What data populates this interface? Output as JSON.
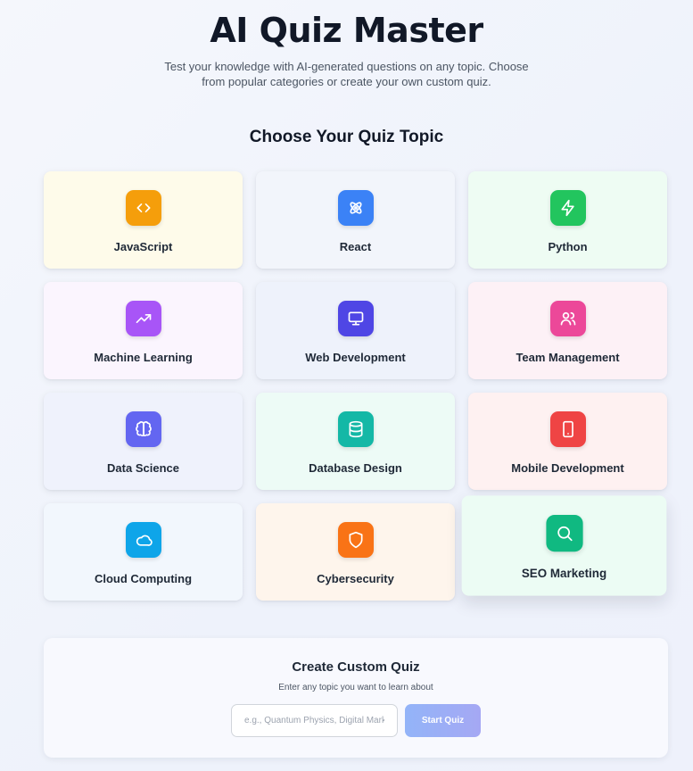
{
  "header": {
    "title": "AI Quiz Master",
    "subtitle": "Test your knowledge with AI-generated questions on any topic. Choose from popular categories or create your own custom quiz."
  },
  "topics_section": {
    "title": "Choose Your Quiz Topic",
    "topics": [
      {
        "label": "JavaScript",
        "icon": "code-icon",
        "accent": "#f59e0b",
        "bg": "#fefbea"
      },
      {
        "label": "React",
        "icon": "atom-icon",
        "accent": "#3b82f6",
        "bg": "#f2f5fb"
      },
      {
        "label": "Python",
        "icon": "lightning-icon",
        "accent": "#22c55e",
        "bg": "#eefcf3"
      },
      {
        "label": "Machine Learning",
        "icon": "trending-up-icon",
        "accent": "#a855f7",
        "bg": "#fbf5fe"
      },
      {
        "label": "Web Development",
        "icon": "monitor-icon",
        "accent": "#4f46e5",
        "bg": "#eef2fb"
      },
      {
        "label": "Team Management",
        "icon": "users-icon",
        "accent": "#ec4899",
        "bg": "#fdf1f6"
      },
      {
        "label": "Data Science",
        "icon": "brain-icon",
        "accent": "#6366f1",
        "bg": "#eff2fc"
      },
      {
        "label": "Database Design",
        "icon": "database-icon",
        "accent": "#14b8a6",
        "bg": "#edfbf6"
      },
      {
        "label": "Mobile Development",
        "icon": "smartphone-icon",
        "accent": "#ef4444",
        "bg": "#fef1f1"
      },
      {
        "label": "Cloud Computing",
        "icon": "cloud-icon",
        "accent": "#0ea5e9",
        "bg": "#f2f7fd"
      },
      {
        "label": "Cybersecurity",
        "icon": "shield-icon",
        "accent": "#f97316",
        "bg": "#fef5ec"
      },
      {
        "label": "SEO Marketing",
        "icon": "search-icon",
        "accent": "#10b981",
        "bg": "#ecfcf4"
      }
    ]
  },
  "custom_quiz": {
    "title": "Create Custom Quiz",
    "description": "Enter any topic you want to learn about",
    "input_placeholder": "e.g., Quantum Physics, Digital Marketing",
    "input_value": "",
    "start_label": "Start Quiz"
  }
}
